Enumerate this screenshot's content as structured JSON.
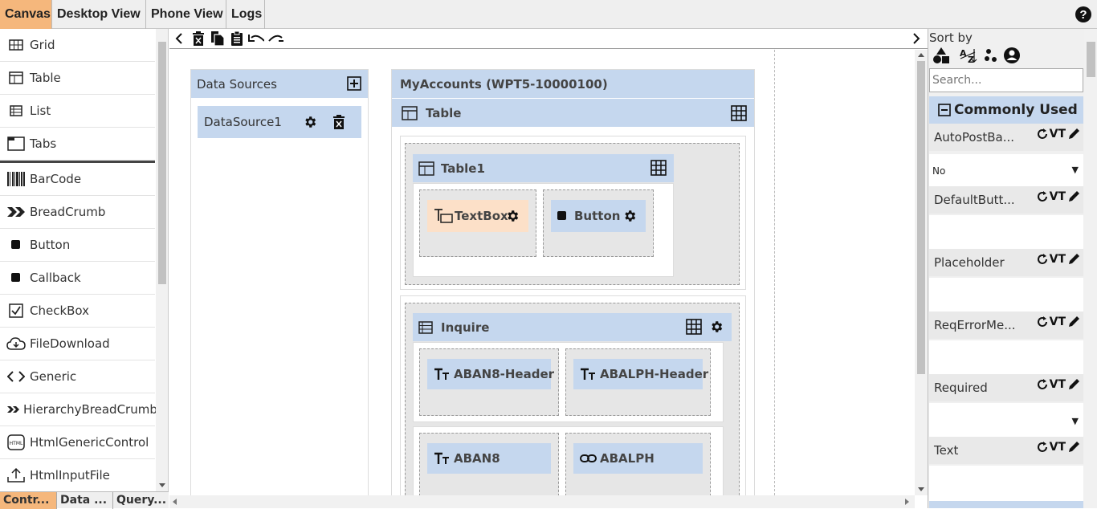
{
  "top_tabs": [
    "Canvas",
    "Desktop View",
    "Phone View",
    "Logs"
  ],
  "help_label": "?",
  "toolbox": {
    "items": [
      "Grid",
      "Table",
      "List",
      "Tabs",
      "BarCode",
      "BreadCrumb",
      "Button",
      "Callback",
      "CheckBox",
      "FileDownload",
      "Generic",
      "HierarchyBreadCrumb",
      "HtmlGenericControl",
      "HtmlInputFile"
    ],
    "bottom_tabs": [
      "Contr...",
      "Data ...",
      "Query..."
    ]
  },
  "canvas": {
    "data_sources": {
      "title": "Data Sources",
      "items": [
        "DataSource1"
      ]
    },
    "main": {
      "title": "MyAccounts (WPT5-10000100)",
      "table_header": "Table",
      "table1": {
        "title": "Table1",
        "cells": [
          "TextBox",
          "Button"
        ]
      },
      "inquire": {
        "title": "Inquire",
        "row1": [
          "ABAN8-Header",
          "ABALPH-Header"
        ],
        "row2": [
          "ABAN8",
          "ABALPH"
        ]
      }
    }
  },
  "props": {
    "sort_by": "Sort by",
    "search_placeholder": "Search...",
    "category": "Commonly Used",
    "vt_label": "VT",
    "rows": [
      {
        "name": "AutoPostBa...",
        "value": "No",
        "dropdown": true
      },
      {
        "name": "DefaultButt...",
        "value": "",
        "dropdown": false
      },
      {
        "name": "Placeholder",
        "value": "",
        "dropdown": false
      },
      {
        "name": "ReqErrorMe...",
        "value": "",
        "dropdown": false
      },
      {
        "name": "Required",
        "value": "",
        "dropdown": true
      },
      {
        "name": "Text",
        "value": "",
        "dropdown": false
      }
    ]
  }
}
